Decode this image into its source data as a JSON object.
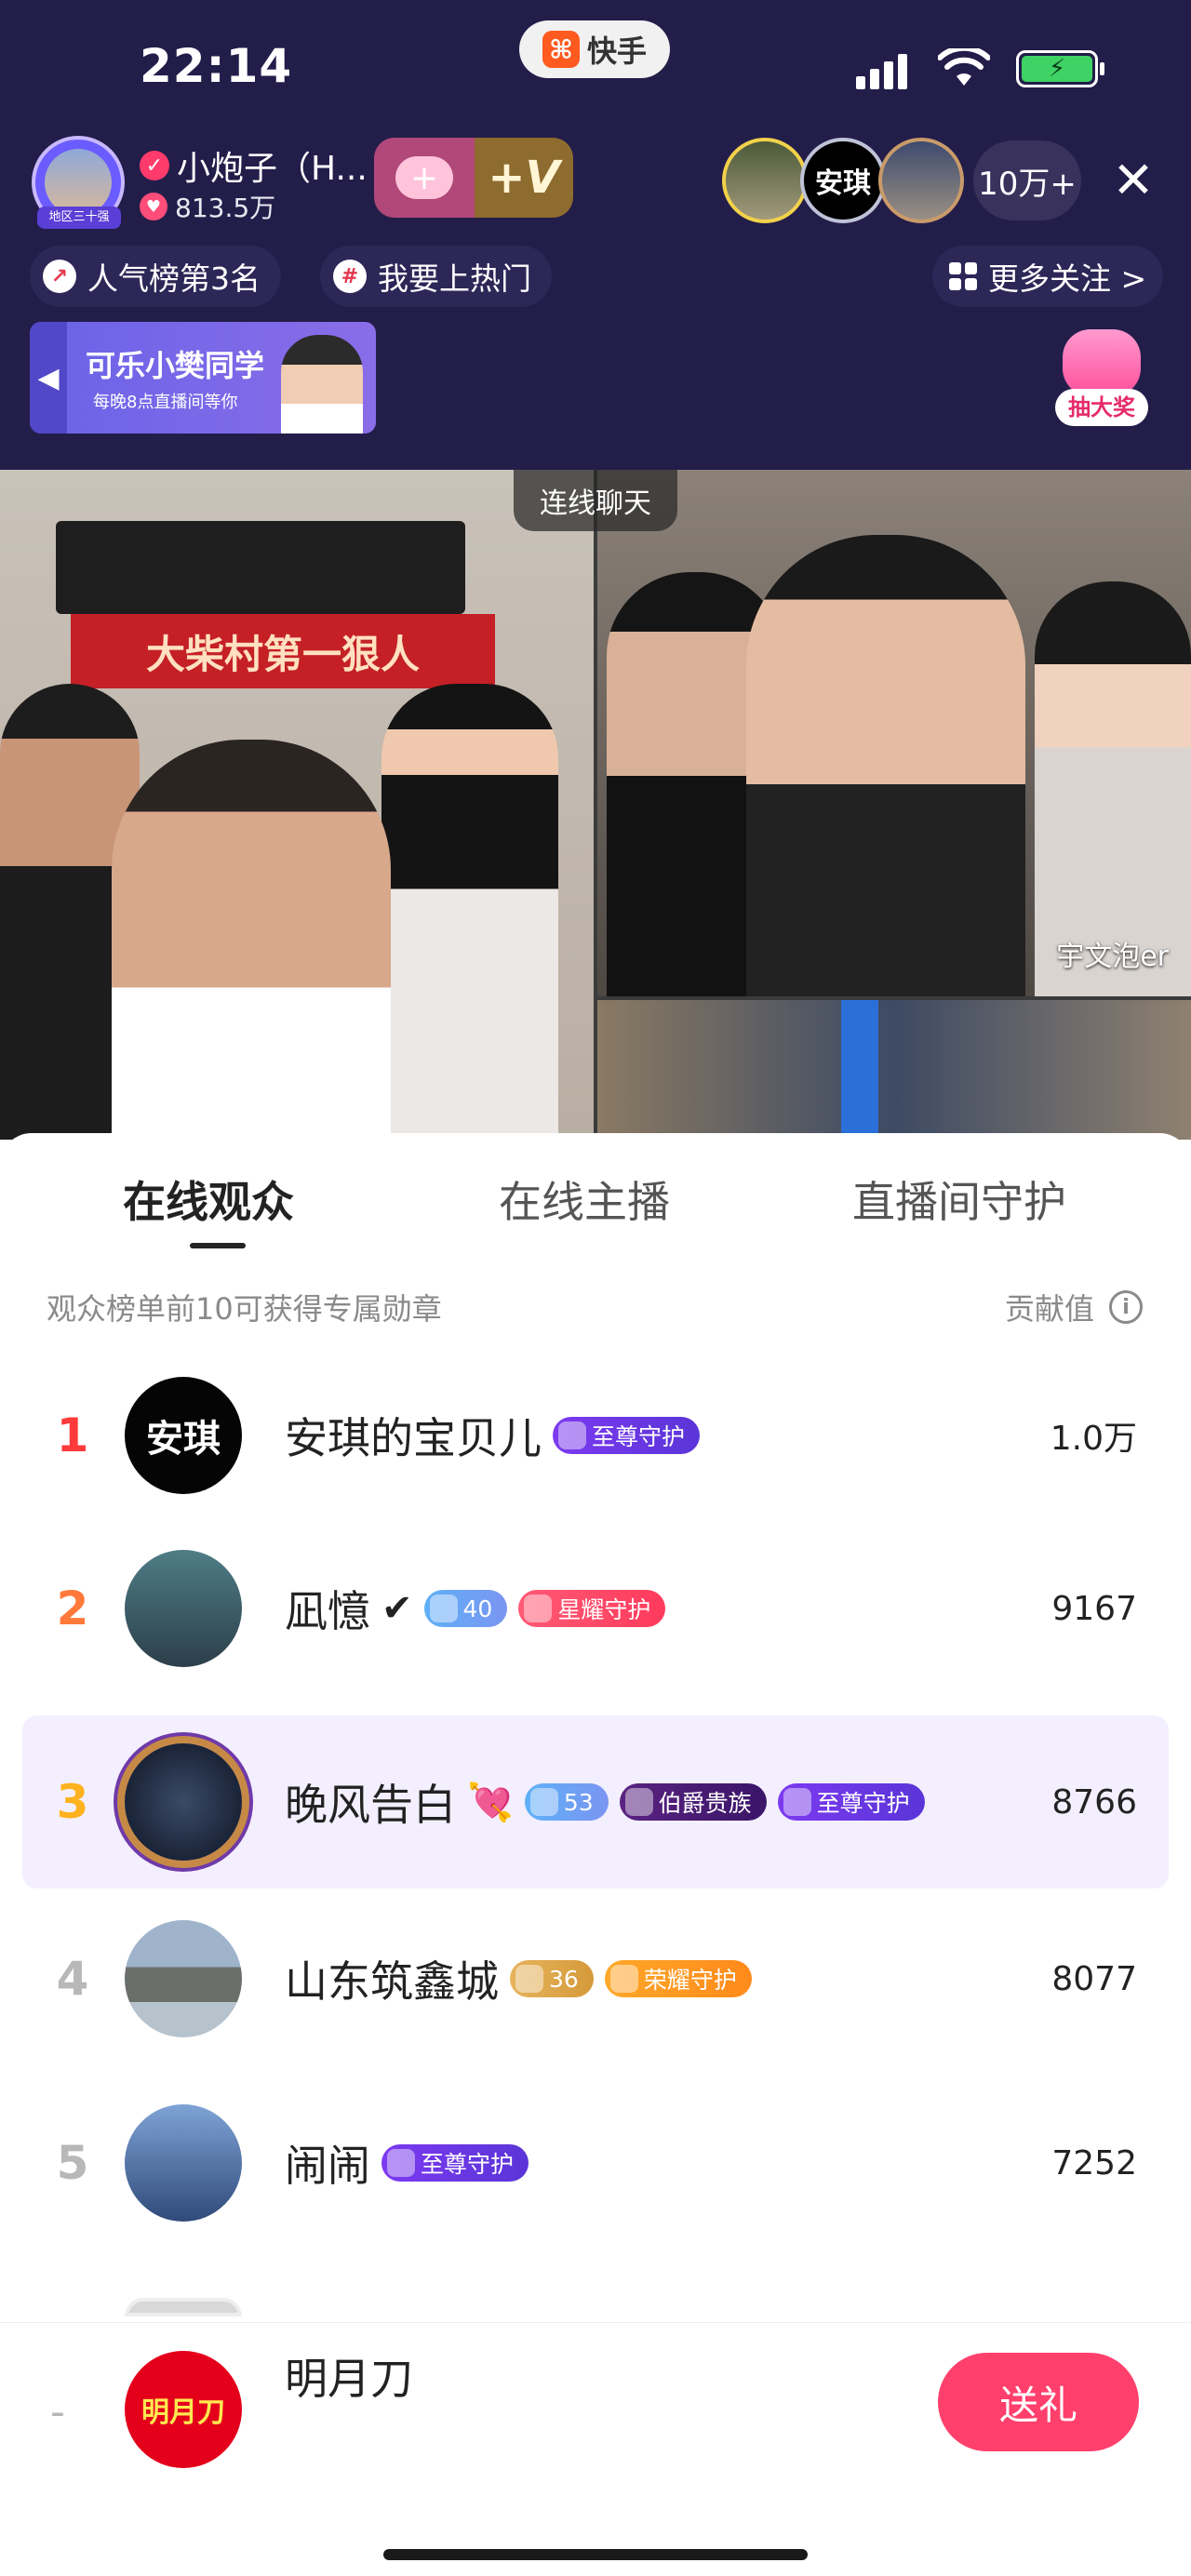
{
  "status_bar": {
    "time": "22:14",
    "app_name": "快手"
  },
  "host": {
    "name": "小炮子（H...",
    "likes": "813.5万",
    "avatar_tag": "地区三十强",
    "follow_button": "+",
    "vip_button": "+V"
  },
  "viewers": {
    "top": [
      "",
      "安琪",
      ""
    ],
    "count": "10万+"
  },
  "chips": {
    "popularity": "人气榜第3名",
    "hot": "我要上热门",
    "more": "更多关注 >"
  },
  "banner": {
    "title": "可乐小樊同学",
    "subtitle": "每晚8点直播间等你"
  },
  "lottery": {
    "label": "抽大奖"
  },
  "video": {
    "left_slogan": "大柴村第一狠人",
    "link_chat": "连线聊天",
    "right_top_user": "宇文泡er"
  },
  "sheet": {
    "tabs": [
      "在线观众",
      "在线主播",
      "直播间守护"
    ],
    "hint": "观众榜单前10可获得专属勋章",
    "contribution_label": "贡献值"
  },
  "ranking": [
    {
      "rank": "1",
      "avatar_text": "安琪",
      "name": "安琪的宝贝儿",
      "suffix": "",
      "badges": [
        {
          "text": "至尊守护",
          "color": "purple"
        }
      ],
      "score": "1.0万"
    },
    {
      "rank": "2",
      "avatar_text": "",
      "name": "凪憶",
      "suffix": "✔",
      "badges": [
        {
          "text": "40",
          "color": "blue"
        },
        {
          "text": "星耀守护",
          "color": "red"
        }
      ],
      "score": "9167"
    },
    {
      "rank": "3",
      "avatar_text": "",
      "name": "晚风告白",
      "suffix": "💘",
      "badges": [
        {
          "text": "53",
          "color": "blue"
        },
        {
          "text": "伯爵贵族",
          "color": "dark"
        },
        {
          "text": "至尊守护",
          "color": "purple"
        }
      ],
      "score": "8766"
    },
    {
      "rank": "4",
      "avatar_text": "",
      "name": "山东筑鑫城",
      "suffix": "",
      "badges": [
        {
          "text": "36",
          "color": "gold"
        },
        {
          "text": "荣耀守护",
          "color": "orange"
        }
      ],
      "score": "8077"
    },
    {
      "rank": "5",
      "avatar_text": "",
      "name": "闹闹",
      "suffix": "",
      "badges": [
        {
          "text": "至尊守护",
          "color": "purple"
        }
      ],
      "score": "7252"
    }
  ],
  "me": {
    "rank": "-",
    "avatar_text": "明月刀",
    "name": "明月刀",
    "gift_button": "送礼"
  }
}
